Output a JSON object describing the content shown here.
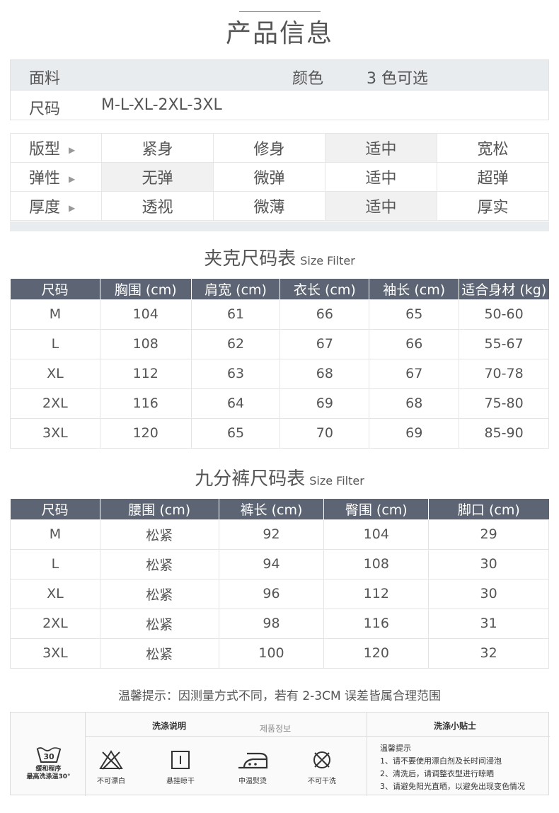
{
  "page_title": "产品信息",
  "info": {
    "fabric_label": "面料",
    "color_label": "颜色",
    "color_value": "3 色可选",
    "size_label": "尺码",
    "size_value": "M-L-XL-2XL-3XL"
  },
  "attributes": [
    {
      "label": "版型",
      "options": [
        "紧身",
        "修身",
        "适中",
        "宽松"
      ],
      "selected": 2
    },
    {
      "label": "弹性",
      "options": [
        "无弹",
        "微弹",
        "适中",
        "超弹"
      ],
      "selected": 0
    },
    {
      "label": "厚度",
      "options": [
        "透视",
        "微薄",
        "适中",
        "厚实"
      ],
      "selected": 2
    }
  ],
  "jacket": {
    "title": "夹克尺码表",
    "subtitle": "Size Filter",
    "headers": [
      "尺码",
      "胸围 (cm)",
      "肩宽 (cm)",
      "衣长 (cm)",
      "袖长 (cm)",
      "适合身材 (kg)"
    ],
    "rows": [
      [
        "M",
        "104",
        "61",
        "66",
        "65",
        "50-60"
      ],
      [
        "L",
        "108",
        "62",
        "67",
        "66",
        "55-67"
      ],
      [
        "XL",
        "112",
        "63",
        "68",
        "67",
        "70-78"
      ],
      [
        "2XL",
        "116",
        "64",
        "69",
        "68",
        "75-80"
      ],
      [
        "3XL",
        "120",
        "65",
        "70",
        "69",
        "85-90"
      ]
    ]
  },
  "pants": {
    "title": "九分裤尺码表",
    "subtitle": "Size Filter",
    "headers": [
      "尺码",
      "腰围 (cm)",
      "裤长 (cm)",
      "臀围 (cm)",
      "脚口 (cm)"
    ],
    "rows": [
      [
        "M",
        "松紧",
        "92",
        "104",
        "29"
      ],
      [
        "L",
        "松紧",
        "94",
        "108",
        "30"
      ],
      [
        "XL",
        "松紧",
        "96",
        "112",
        "30"
      ],
      [
        "2XL",
        "松紧",
        "98",
        "116",
        "31"
      ],
      [
        "3XL",
        "松紧",
        "100",
        "120",
        "32"
      ]
    ]
  },
  "tip": "温馨提示：因测量方式不同，若有 2-3CM 误差皆属合理范围",
  "care": {
    "wash_header": "洗涤说明",
    "korean_label": "제품정보",
    "tips_header": "洗涤小贴士",
    "wash_temp": "30",
    "wash_line1": "缓和程序",
    "wash_line2": "最高洗涤温30°",
    "icons": [
      "不可漂白",
      "悬挂晾干",
      "中温熨烫",
      "不可干洗"
    ],
    "tips_title": "温馨提示",
    "tips_lines": [
      "1、请不要使用漂白剂及长时间浸泡",
      "2、清洗后，请调整衣型进行晾晒",
      "3、请避免阳光直晒，以避免出现变色情况"
    ]
  }
}
